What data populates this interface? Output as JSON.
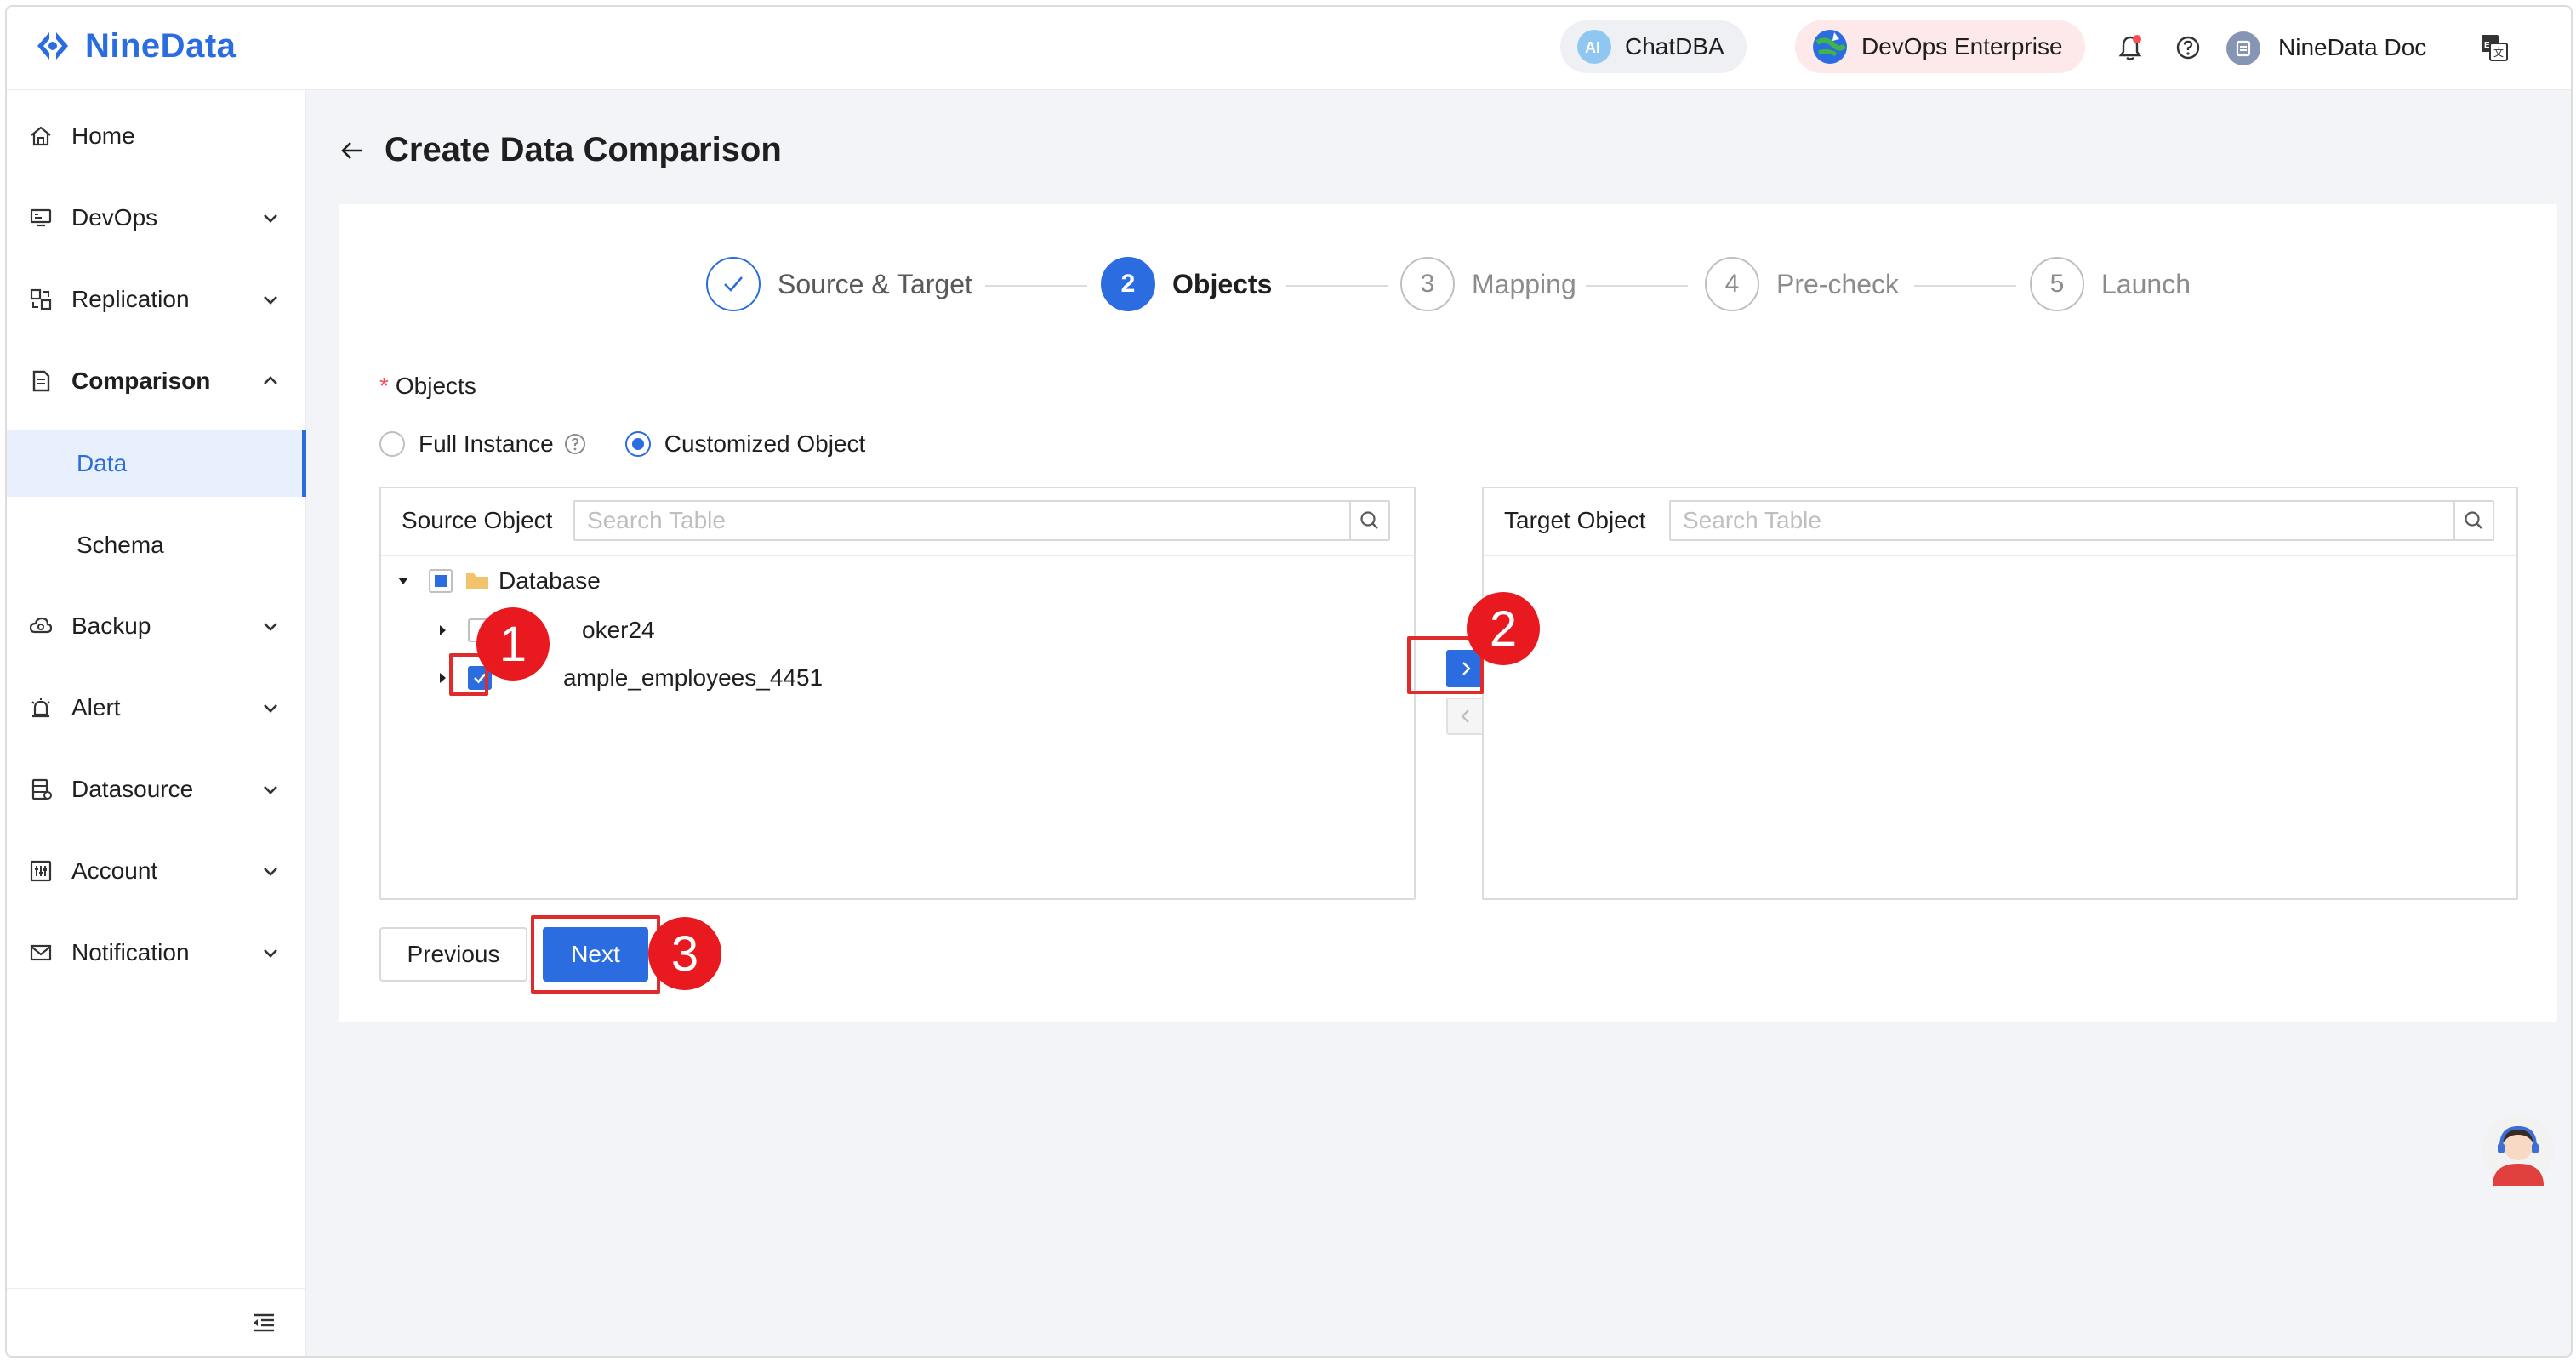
{
  "brand": {
    "name": "NineData",
    "accent": "#2b6de0"
  },
  "header": {
    "chatdba_label": "ChatDBA",
    "devops_label": "DevOps Enterprise",
    "doc_label": "NineData Doc",
    "icons": [
      "ai-icon",
      "globe-icon",
      "bell-icon",
      "help-icon",
      "user-icon",
      "translate-icon"
    ]
  },
  "sidebar": {
    "items": [
      {
        "label": "Home",
        "icon": "home-icon"
      },
      {
        "label": "DevOps",
        "icon": "monitor-icon"
      },
      {
        "label": "Replication",
        "icon": "replication-icon"
      },
      {
        "label": "Comparison",
        "icon": "comparison-icon"
      },
      {
        "label": "Backup",
        "icon": "cloud-icon"
      },
      {
        "label": "Alert",
        "icon": "alarm-icon"
      },
      {
        "label": "Datasource",
        "icon": "database-icon"
      },
      {
        "label": "Account",
        "icon": "account-icon"
      },
      {
        "label": "Notification",
        "icon": "mail-icon"
      }
    ],
    "comparison_sub": [
      {
        "label": "Data",
        "active": true
      },
      {
        "label": "Schema",
        "active": false
      }
    ]
  },
  "page": {
    "title": "Create Data Comparison",
    "steps": [
      {
        "num": "1",
        "label": "Source & Target",
        "status": "done"
      },
      {
        "num": "2",
        "label": "Objects",
        "status": "active"
      },
      {
        "num": "3",
        "label": "Mapping",
        "status": "pending"
      },
      {
        "num": "4",
        "label": "Pre-check",
        "status": "pending"
      },
      {
        "num": "5",
        "label": "Launch",
        "status": "pending"
      }
    ],
    "objects_label": "Objects",
    "radio_full": "Full Instance",
    "radio_custom": "Customized Object",
    "selected_radio": "Customized Object",
    "source": {
      "title": "Source Object",
      "search_placeholder": "Search Table",
      "tree": {
        "root": "Database",
        "children": [
          "poker24",
          "sample_employees_4451"
        ],
        "child_1_visible": "oker24",
        "child_2_visible": "ample_employees_4451"
      }
    },
    "target": {
      "title": "Target Object",
      "search_placeholder": "Search Table"
    },
    "buttons": {
      "previous": "Previous",
      "next": "Next"
    },
    "annotations": [
      "1",
      "2",
      "3"
    ]
  }
}
